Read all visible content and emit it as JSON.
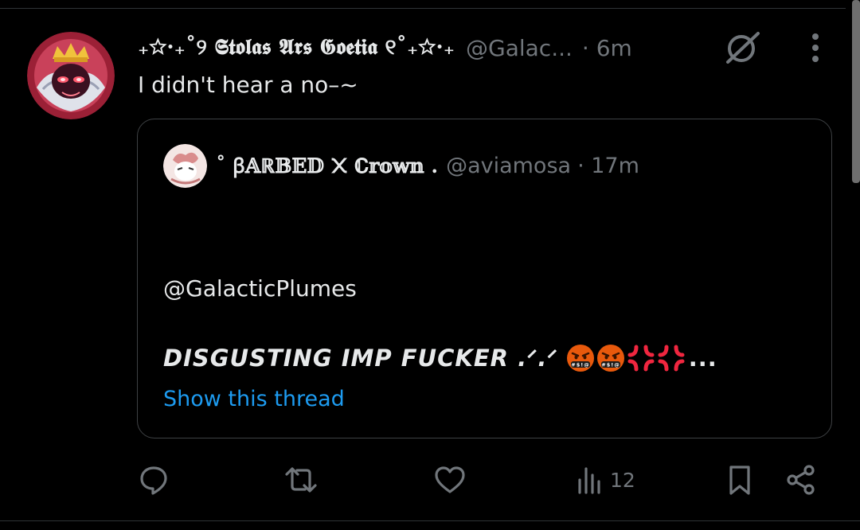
{
  "post": {
    "display_name": "₊☆·₊˚୨ 𝕾𝖙𝖔𝖑𝖆𝖘 𝕬𝖗𝖘 𝕲𝖔𝖊𝖙𝖎𝖆 ୧˚₊☆·₊",
    "handle": "@Galac...",
    "time": "· 6m",
    "text": "I didn't hear a no–~",
    "avatar_icon": "avatar-owl-prince-icon",
    "grok_icon": "grok-icon",
    "more_icon": "more-options-icon"
  },
  "quote": {
    "display_name": "˚ ꞵ𝔸ℝ𝔹𝔼𝔻 ᙭ ℂ𝕣𝕠𝕨𝕟 .",
    "handle": "@aviamosa",
    "time": "· 17m",
    "mention": "@GalacticPlumes",
    "headline": "DISGUSTING IMP FUCKER .ᐟ.ᐟ",
    "ellipsis": "...",
    "show_thread": "Show this thread",
    "emojis": [
      "face-with-symbols-on-mouth",
      "face-with-symbols-on-mouth",
      "anger-symbol",
      "anger-symbol"
    ]
  },
  "actions": {
    "reply_icon": "reply-icon",
    "retweet_icon": "retweet-icon",
    "like_icon": "like-icon",
    "views_icon": "views-icon",
    "views_count": "12",
    "bookmark_icon": "bookmark-icon",
    "share_icon": "share-icon"
  },
  "colors": {
    "background": "#000000",
    "text": "#e7e9ea",
    "muted": "#71767b",
    "link": "#1d9bf0",
    "border": "#3e4144"
  }
}
